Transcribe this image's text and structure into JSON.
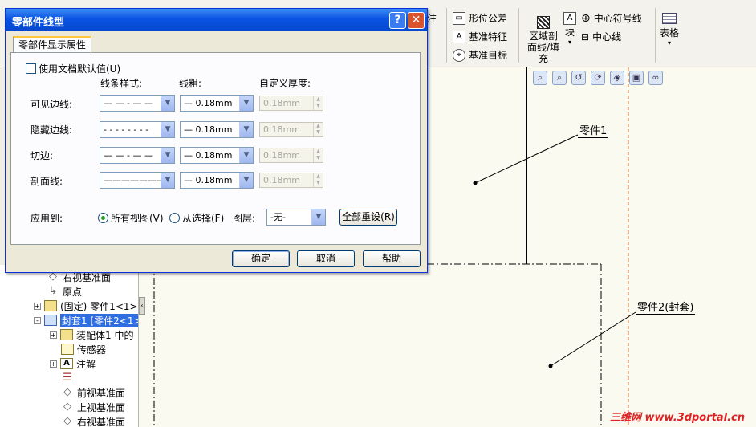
{
  "ribbon": {
    "partial_left": "注",
    "items": [
      {
        "label": "形位公差",
        "icon": "geometric-tolerance-icon"
      },
      {
        "label": "基准特征",
        "icon": "datum-feature-icon"
      },
      {
        "label": "基准目标",
        "icon": "datum-target-icon"
      },
      {
        "label": "区域剖面线/填充",
        "icon": "area-hatch-icon"
      },
      {
        "label": "块",
        "icon": "block-icon"
      },
      {
        "label": "中心符号线",
        "icon": "center-mark-icon"
      },
      {
        "label": "中心线",
        "icon": "centerline-icon"
      },
      {
        "label": "表格",
        "icon": "table-icon"
      }
    ]
  },
  "view_toolbar": [
    "zoom-to-fit-icon",
    "zoom-area-icon",
    "previous-view-icon",
    "rebuild-icon",
    "3d-view-icon",
    "display-style-icon",
    "hide-show-icon"
  ],
  "tree": {
    "items": [
      {
        "label": "右视基准面",
        "icon": "plane-icon",
        "expand": ""
      },
      {
        "label": "原点",
        "icon": "origin-icon",
        "expand": ""
      },
      {
        "label": "(固定) 零件1<1>",
        "icon": "part-icon",
        "expand": "+"
      },
      {
        "label": "封套1 [零件2<1>",
        "icon": "envelope-icon",
        "expand": "-",
        "selected": true
      },
      {
        "label": "装配体1 中的",
        "icon": "assembly-icon",
        "expand": "+"
      },
      {
        "label": "传感器",
        "icon": "sensor-icon",
        "expand": ""
      },
      {
        "label": "注解",
        "icon": "annotation-icon",
        "expand": "+"
      },
      {
        "label": "",
        "icon": "list-icon",
        "expand": ""
      },
      {
        "label": "前视基准面",
        "icon": "plane-icon",
        "expand": ""
      },
      {
        "label": "上视基准面",
        "icon": "plane-icon",
        "expand": ""
      },
      {
        "label": "右视基准面",
        "icon": "plane-icon",
        "expand": ""
      }
    ]
  },
  "canvas": {
    "label1": "零件1",
    "label2": "零件2(封套)"
  },
  "dialog": {
    "title": "零部件线型",
    "help_icon": "?",
    "close_icon": "✕",
    "tab": "零部件显示属性",
    "use_doc_defaults": "使用文档默认值(U)",
    "use_doc_defaults_checked": false,
    "col_style": "线条样式:",
    "col_weight": "线粗:",
    "col_thickness": "自定义厚度:",
    "rows": [
      {
        "label": "可见边线:",
        "style": "— — - — —",
        "weight": "— 0.18mm",
        "thickness": "0.18mm"
      },
      {
        "label": "隐藏边线:",
        "style": "- - - - - - - -",
        "weight": "— 0.18mm",
        "thickness": "0.18mm"
      },
      {
        "label": "切边:",
        "style": "— — - — —",
        "weight": "— 0.18mm",
        "thickness": "0.18mm"
      },
      {
        "label": "剖面线:",
        "style": "————————",
        "weight": "— 0.18mm",
        "thickness": "0.18mm"
      }
    ],
    "apply_to": "应用到:",
    "all_views": "所有视图(V)",
    "from_selection": "从选择(F)",
    "all_views_selected": true,
    "layer_label": "图层:",
    "layer_value": "-无-",
    "reset_all": "全部重设(R)",
    "ok": "确定",
    "cancel": "取消",
    "help": "帮助"
  },
  "watermark": "三维网 www.3dportal.cn"
}
